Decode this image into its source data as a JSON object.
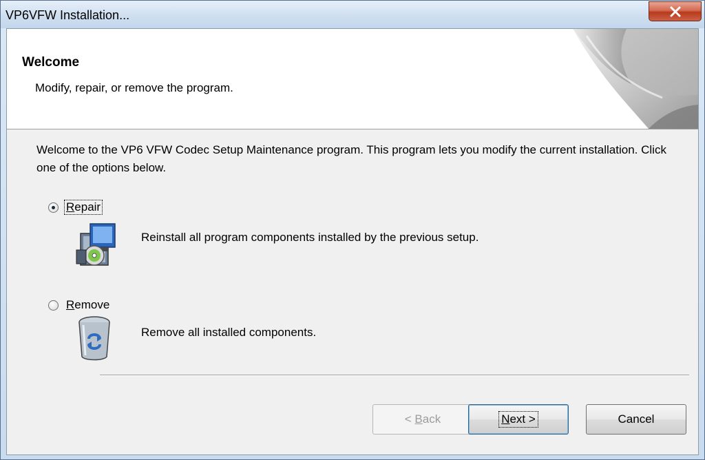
{
  "window": {
    "title": "VP6VFW Installation...",
    "close_label": "X"
  },
  "header": {
    "title": "Welcome",
    "subtitle": "Modify, repair, or remove the program."
  },
  "body": {
    "welcome_text": "Welcome to the VP6 VFW Codec Setup Maintenance program. This program lets you modify the current installation. Click one of the options below."
  },
  "options": {
    "repair": {
      "label_access_key": "R",
      "label_rest": "epair",
      "description": "Reinstall all program components installed by the previous setup.",
      "selected": true,
      "icon": "setup-box-icon"
    },
    "remove": {
      "label_access_key": "R",
      "label_rest": "emove",
      "description": "Remove all installed components.",
      "selected": false,
      "icon": "recycle-bin-icon"
    }
  },
  "buttons": {
    "back": {
      "prefix": "< ",
      "access_key": "B",
      "rest": "ack",
      "enabled": false
    },
    "next": {
      "access_key": "N",
      "rest": "ext >",
      "enabled": true
    },
    "cancel": {
      "label": "Cancel",
      "enabled": true
    }
  },
  "colors": {
    "close_button": "#c8432a",
    "dialog_face": "#f0f0f0",
    "header_background": "#ffffff",
    "default_button_border": "#2c628b"
  }
}
